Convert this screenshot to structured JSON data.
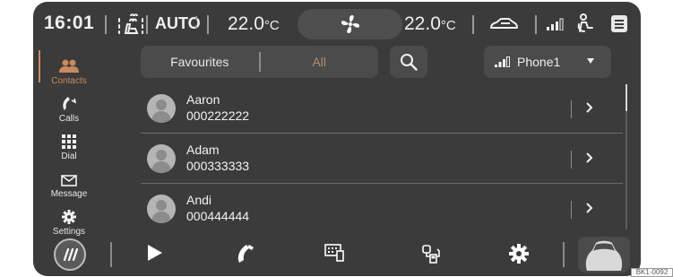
{
  "status_bar": {
    "time": "16:01",
    "climate_mode": "AUTO",
    "temp_left_value": "22.0",
    "temp_right_value": "22.0",
    "temp_unit": "°C",
    "icons": [
      "seat-heating-icon",
      "fan-icon",
      "car-icon",
      "signal-icon",
      "person-icon",
      "menu-icon"
    ]
  },
  "sidebar": {
    "items": [
      {
        "label": "Contacts",
        "icon": "contacts-icon",
        "active": true
      },
      {
        "label": "Calls",
        "icon": "phone-icon",
        "active": false
      },
      {
        "label": "Dial",
        "icon": "keypad-icon",
        "active": false
      },
      {
        "label": "Message",
        "icon": "envelope-icon",
        "active": false
      },
      {
        "label": "Settings",
        "icon": "gear-icon",
        "active": false
      }
    ]
  },
  "tabs": {
    "favourites": "Favourites",
    "all": "All",
    "selected": "All"
  },
  "phone_selector": {
    "value": "Phone1"
  },
  "contacts": [
    {
      "name": "Aaron",
      "number": "000222222"
    },
    {
      "name": "Adam",
      "number": "000333333"
    },
    {
      "name": "Andi",
      "number": "000444444"
    }
  ],
  "bottom_bar": {
    "icons": [
      "home-icon",
      "play-icon",
      "phone-icon",
      "smartlink-icon",
      "fuel-icon",
      "gear-icon",
      "car-icon"
    ],
    "page_count": 2,
    "current_page": 1
  },
  "colors": {
    "accent": "#c98a5e",
    "background": "#3b3b3b",
    "panel": "#4b4b4b"
  },
  "corner_label": "BK1-0092"
}
